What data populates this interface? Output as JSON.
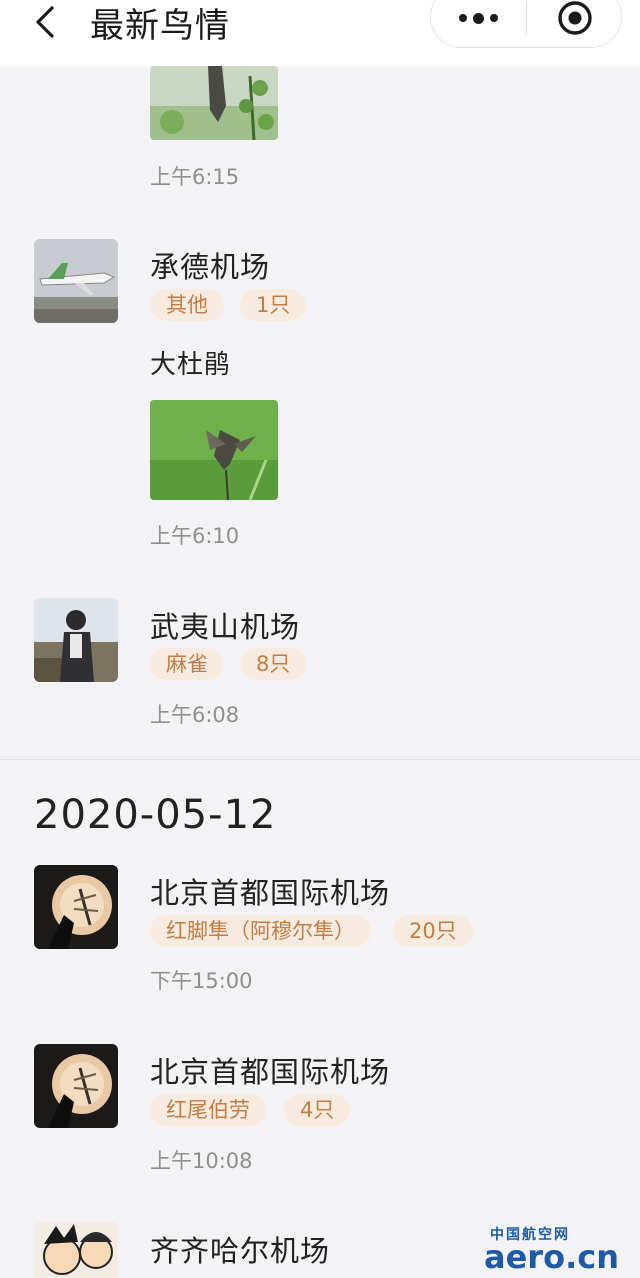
{
  "header": {
    "title": "最新鸟情",
    "back_icon": "chevron-left-icon",
    "more_icon": "more-dots-icon",
    "target_icon": "target-icon"
  },
  "entries": [
    {
      "time": "上午6:15"
    },
    {
      "airport": "承德机场",
      "tags": [
        "其他",
        "1只"
      ],
      "species": "大杜鹃",
      "time": "上午6:10"
    },
    {
      "airport": "武夷山机场",
      "tags": [
        "麻雀",
        "8只"
      ],
      "time": "上午6:08"
    }
  ],
  "section": {
    "date": "2020-05-12"
  },
  "section_entries": [
    {
      "airport": "北京首都国际机场",
      "tags": [
        "红脚隼（阿穆尔隼）",
        "20只"
      ],
      "time": "下午15:00"
    },
    {
      "airport": "北京首都国际机场",
      "tags": [
        "红尾伯劳",
        "4只"
      ],
      "time": "上午10:08"
    },
    {
      "airport": "齐齐哈尔机场"
    }
  ],
  "watermark": {
    "line1": "中国航空网",
    "line2": "aero.cn"
  },
  "colors": {
    "tag_bg": "#f7ebe0",
    "tag_text": "#c27e46",
    "page_bg": "#f3f3f5"
  }
}
